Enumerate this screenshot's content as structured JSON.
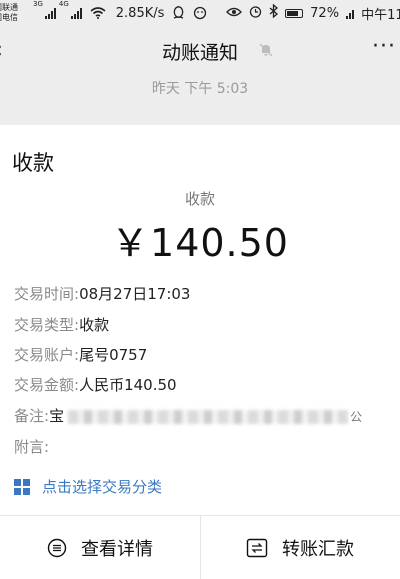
{
  "status_bar": {
    "carrier_1": "国联通",
    "carrier_2": "国电信",
    "net_1": "3G",
    "net_2": "4G",
    "speed": "2.85K/s",
    "battery": "72%",
    "time": "中午11:"
  },
  "nav": {
    "title": "动账通知",
    "more": "···"
  },
  "date": "昨天 下午 5:03",
  "card": {
    "title": "收款",
    "amount_label": "收款",
    "amount": "￥140.50",
    "details": [
      {
        "label": "交易时间:",
        "value": "08月27日17:03"
      },
      {
        "label": "交易类型:",
        "value": "收款"
      },
      {
        "label": "交易账户:",
        "value": "尾号0757"
      },
      {
        "label": "交易金额:",
        "value": "人民币140.50"
      }
    ],
    "remark_label": "备注:",
    "remark_value_start": "宝",
    "remark_value_end": "公",
    "note_label": "附言:",
    "category_link": "点击选择交易分类"
  },
  "actions": {
    "details_label": "查看详情",
    "transfer_label": "转账汇款"
  },
  "colors": {
    "link": "#3a78c3",
    "background": "#ededed",
    "card": "#ffffff"
  }
}
